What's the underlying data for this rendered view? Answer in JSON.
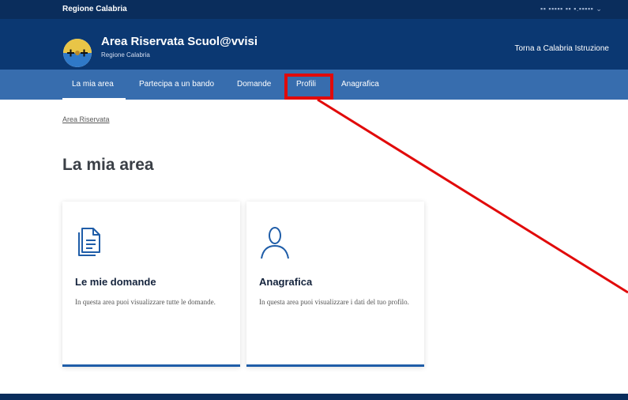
{
  "slim_header": {
    "brand": "Regione Calabria",
    "user": "▪▪ ▪▪▪▪▪ ▪▪ ▪.▪▪▪▪▪ ⌄"
  },
  "site": {
    "title": "Area Riservata Scuol@vvisi",
    "subtitle": "Regione Calabria",
    "back_link": "Torna a Calabria Istruzione",
    "logo_icon": "regione-calabria-logo-icon"
  },
  "nav": {
    "items": [
      {
        "label": "La mia area",
        "active": true
      },
      {
        "label": "Partecipa a un bando"
      },
      {
        "label": "Domande"
      },
      {
        "label": "Profili",
        "highlighted": true
      },
      {
        "label": "Anagrafica"
      }
    ]
  },
  "breadcrumb": "Area Riservata",
  "page_title": "La mia area",
  "cards": [
    {
      "icon": "document-icon",
      "title": "Le mie domande",
      "text": "In questa area puoi visualizzare tutte le domande."
    },
    {
      "icon": "user-icon",
      "title": "Anagrafica",
      "text": "In questa area puoi visualizzare i dati del tuo profilo."
    }
  ],
  "colors": {
    "header": "#0b3872",
    "nav": "#376dae",
    "accent": "#1f5da8",
    "annotation": "#e10a0a"
  }
}
